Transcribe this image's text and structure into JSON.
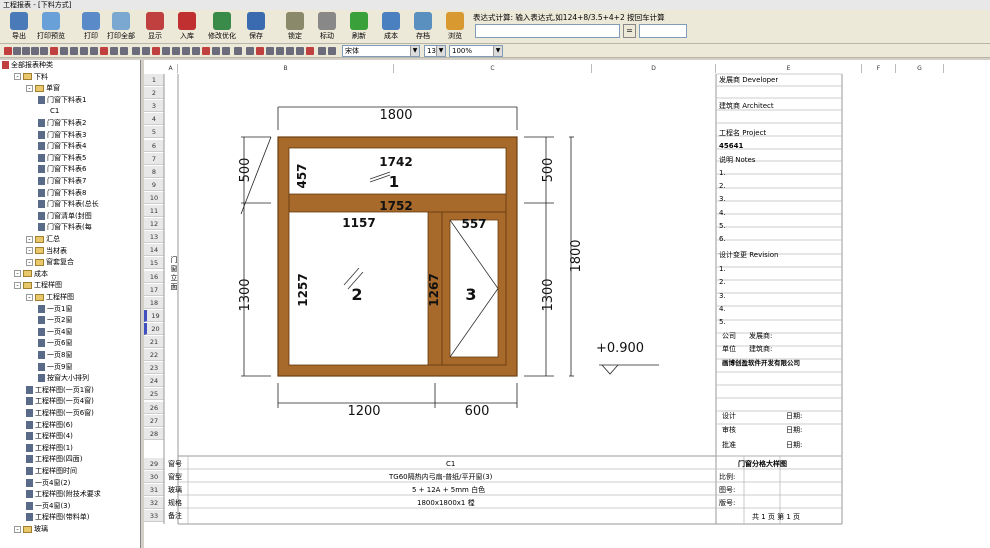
{
  "window": {
    "title": "工程报表 - [下料方式]"
  },
  "toolbar": {
    "buttons": [
      "导出",
      "打印预览",
      "打印",
      "打印全部",
      "显示",
      "入库",
      "修改优化",
      "保存",
      "锁定",
      "标动",
      "刷新",
      "成本",
      "存档",
      "浏览"
    ]
  },
  "formula": {
    "label": "表达式计算: 输入表达式,如124+8/3.5+4+2 按回车计算",
    "equals": "=",
    "input": "",
    "result": ""
  },
  "format": {
    "font": "宋体",
    "size": "13",
    "zoom": "100%"
  },
  "tree": {
    "items": [
      {
        "t": "全部报表种类",
        "lv": 0,
        "k": "root"
      },
      {
        "t": "下料",
        "lv": 1,
        "k": "fold"
      },
      {
        "t": "单窗",
        "lv": 2,
        "k": "fold"
      },
      {
        "t": "门窗下料表1",
        "lv": 3,
        "k": "doc"
      },
      {
        "t": "C1",
        "lv": 4,
        "k": "none"
      },
      {
        "t": "门窗下料表2",
        "lv": 3,
        "k": "doc"
      },
      {
        "t": "门窗下料表3",
        "lv": 3,
        "k": "doc"
      },
      {
        "t": "门窗下料表4",
        "lv": 3,
        "k": "doc"
      },
      {
        "t": "门窗下料表5",
        "lv": 3,
        "k": "doc"
      },
      {
        "t": "门窗下料表6",
        "lv": 3,
        "k": "doc"
      },
      {
        "t": "门窗下料表7",
        "lv": 3,
        "k": "doc"
      },
      {
        "t": "门窗下料表8",
        "lv": 3,
        "k": "doc"
      },
      {
        "t": "门窗下料表(总长",
        "lv": 3,
        "k": "doc"
      },
      {
        "t": "门窗清单(封图",
        "lv": 3,
        "k": "doc"
      },
      {
        "t": "门窗下料表(每",
        "lv": 3,
        "k": "doc"
      },
      {
        "t": "汇总",
        "lv": 2,
        "k": "fold"
      },
      {
        "t": "当材表",
        "lv": 2,
        "k": "fold"
      },
      {
        "t": "窗套复合",
        "lv": 2,
        "k": "fold"
      },
      {
        "t": "成本",
        "lv": 1,
        "k": "fold"
      },
      {
        "t": "工程样图",
        "lv": 1,
        "k": "fold"
      },
      {
        "t": "工程样图",
        "lv": 2,
        "k": "fold"
      },
      {
        "t": "一页1窗",
        "lv": 3,
        "k": "doc"
      },
      {
        "t": "一页2窗",
        "lv": 3,
        "k": "doc"
      },
      {
        "t": "一页4窗",
        "lv": 3,
        "k": "doc"
      },
      {
        "t": "一页6窗",
        "lv": 3,
        "k": "doc"
      },
      {
        "t": "一页8窗",
        "lv": 3,
        "k": "doc"
      },
      {
        "t": "一页9窗",
        "lv": 3,
        "k": "doc"
      },
      {
        "t": "按窗大小排列",
        "lv": 3,
        "k": "doc"
      },
      {
        "t": "工程样图(一页1窗)",
        "lv": 2,
        "k": "doc"
      },
      {
        "t": "工程样图(一页4窗)",
        "lv": 2,
        "k": "doc"
      },
      {
        "t": "工程样图(一页6窗)",
        "lv": 2,
        "k": "doc"
      },
      {
        "t": "工程样图(6)",
        "lv": 2,
        "k": "doc"
      },
      {
        "t": "工程样图(4)",
        "lv": 2,
        "k": "doc"
      },
      {
        "t": "工程样图(1)",
        "lv": 2,
        "k": "doc"
      },
      {
        "t": "工程样图(四面)",
        "lv": 2,
        "k": "doc"
      },
      {
        "t": "工程样图时间",
        "lv": 2,
        "k": "doc"
      },
      {
        "t": "一页4窗(2)",
        "lv": 2,
        "k": "doc"
      },
      {
        "t": "工程样图(附技术要求",
        "lv": 2,
        "k": "doc"
      },
      {
        "t": "一页4窗(3)",
        "lv": 2,
        "k": "doc"
      },
      {
        "t": "工程样图(带料单)",
        "lv": 2,
        "k": "doc"
      },
      {
        "t": "玻璃",
        "lv": 1,
        "k": "fold"
      }
    ]
  },
  "sheet": {
    "cols": [
      "A",
      "B",
      "C",
      "D",
      "E",
      "F",
      "G"
    ],
    "rows": [
      "1",
      "2",
      "3",
      "4",
      "5",
      "6",
      "7",
      "8",
      "9",
      "10",
      "11",
      "12",
      "13",
      "14",
      "15",
      "16",
      "17",
      "18",
      "19",
      "20",
      "21",
      "22",
      "23",
      "24",
      "25",
      "26",
      "27",
      "28",
      "29",
      "30",
      "31",
      "32",
      "33"
    ],
    "elevation": "门窗立面",
    "info": {
      "developer": "发展商 Developer",
      "architect": "建筑商 Architect",
      "project": "工程名 Project",
      "projno": "45641",
      "notes": "说明 Notes",
      "revision": "设计变更 Revision",
      "n": [
        "1.",
        "2.",
        "3.",
        "4.",
        "5.",
        "6."
      ],
      "r": [
        "1.",
        "2.",
        "3.",
        "4.",
        "5."
      ],
      "company_lbl": "公司",
      "dev_lbl": "发展商:",
      "unit_lbl": "单位",
      "arch_lbl": "建筑商:",
      "vendor": "画博创盈软件开发有限公司",
      "design": "设计",
      "check": "审核",
      "approve": "批准",
      "date": "日期:",
      "drawing_title": "门窗分格大样图"
    },
    "bottom": {
      "labels": [
        "窗号",
        "窗型",
        "玻璃",
        "规格",
        "备注"
      ],
      "values": [
        "C1",
        "TG60隔热内弓扇-普纸/平开窗(3)",
        "5 + 12A + 5mm 白色",
        "1800x1800x1 樘",
        ""
      ],
      "right": [
        "比例:",
        "图号:",
        "版号:"
      ],
      "page": "共 1 页  第 1 页"
    }
  },
  "drawing": {
    "width": "1800",
    "height": "1800",
    "top_h": "500",
    "bot_h": "1300",
    "top_h_r": "500",
    "bot_h_r": "1300",
    "left_w": "1200",
    "right_w": "600",
    "elev": "+0.900",
    "d1742": "1742",
    "d457": "457",
    "d1752": "1752",
    "d1157": "1157",
    "d557": "557",
    "d1257": "1257",
    "d1267": "1267",
    "p1": "1",
    "p2": "2",
    "p3": "3"
  },
  "colors": {
    "frame": "#a86a2a",
    "frame_dark": "#6b3f12"
  }
}
